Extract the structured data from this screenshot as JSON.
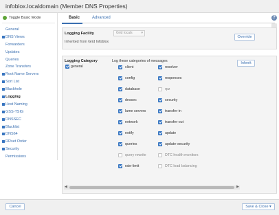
{
  "window": {
    "title": "infoblox.localdomain (Member DNS Properties)"
  },
  "sidebar": {
    "toggle_label": "Toggle Basic Mode",
    "items": [
      {
        "label": "General",
        "checked": false
      },
      {
        "label": "DNS Views",
        "checked": true
      },
      {
        "label": "Forwarders",
        "checked": false
      },
      {
        "label": "Updates",
        "checked": false
      },
      {
        "label": "Queries",
        "checked": false
      },
      {
        "label": "Zone Transfers",
        "checked": false
      },
      {
        "label": "Root Name Servers",
        "checked": true
      },
      {
        "label": "Sort List",
        "checked": true
      },
      {
        "label": "Blackhole",
        "checked": true
      },
      {
        "label": "Logging",
        "checked": true,
        "active": true
      },
      {
        "label": "Host Naming",
        "checked": true
      },
      {
        "label": "GSS-TSIG",
        "checked": true
      },
      {
        "label": "DNSSEC",
        "checked": true
      },
      {
        "label": "Blacklist",
        "checked": true
      },
      {
        "label": "DNS64",
        "checked": true
      },
      {
        "label": "RRset Order",
        "checked": true
      },
      {
        "label": "Security",
        "checked": true
      },
      {
        "label": "Permissions",
        "checked": false
      }
    ]
  },
  "tabs": [
    {
      "label": "Basic",
      "active": true
    },
    {
      "label": "Advanced",
      "active": false
    }
  ],
  "logging_facility": {
    "label": "Logging Facility",
    "select_value": "Grid locals",
    "inherited_text": "Inherited from Grid Infoblox",
    "override_label": "Override"
  },
  "logging_category": {
    "label": "Logging Category",
    "general_label": "general",
    "log_header": "Log these categories of messages",
    "inherit_label": "Inherit",
    "col1": [
      {
        "label": "client",
        "checked": true
      },
      {
        "label": "config",
        "checked": true
      },
      {
        "label": "database",
        "checked": true
      },
      {
        "label": "dnssec",
        "checked": true
      },
      {
        "label": "lame servers",
        "checked": true
      },
      {
        "label": "network",
        "checked": true
      },
      {
        "label": "notify",
        "checked": true
      },
      {
        "label": "queries",
        "checked": true
      },
      {
        "label": "query rewrite",
        "checked": false
      },
      {
        "label": "rate-limit",
        "checked": true
      }
    ],
    "col2": [
      {
        "label": "resolver",
        "checked": true
      },
      {
        "label": "responses",
        "checked": true
      },
      {
        "label": "rpz",
        "checked": false
      },
      {
        "label": "security",
        "checked": true
      },
      {
        "label": "transfer-in",
        "checked": true
      },
      {
        "label": "transfer-out",
        "checked": true
      },
      {
        "label": "update",
        "checked": true
      },
      {
        "label": "update-security",
        "checked": true
      },
      {
        "label": "DTC health monitors",
        "checked": false
      },
      {
        "label": "DTC load balancing",
        "checked": false
      }
    ]
  },
  "footer": {
    "cancel_label": "Cancel",
    "save_label": "Save & Close"
  },
  "colors": {
    "accent": "#3a6fb0",
    "checkbox": "#3a78c3",
    "toggle": "#5fa538"
  }
}
